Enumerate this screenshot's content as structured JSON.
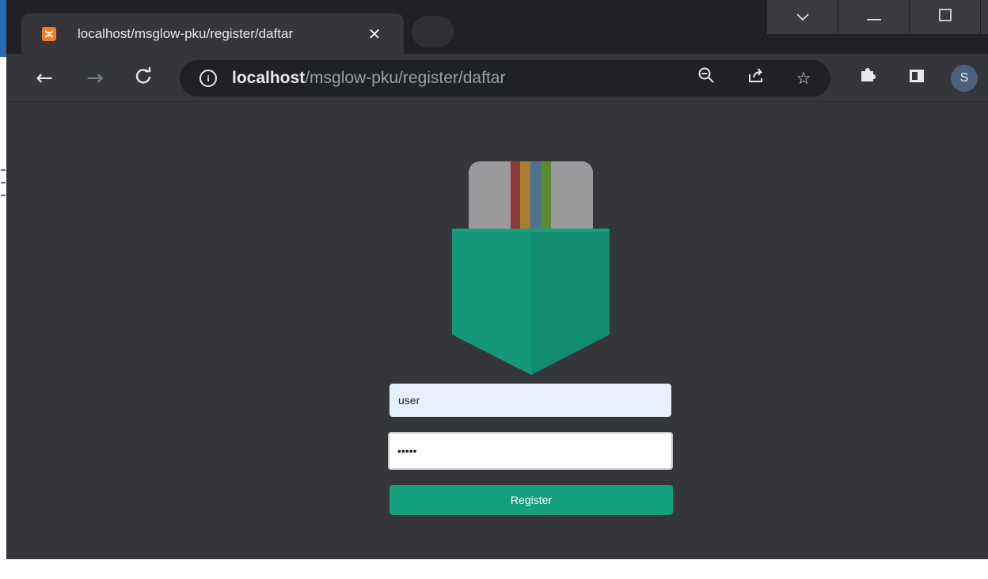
{
  "tab": {
    "title": "localhost/msglow-pku/register/daftar",
    "favicon_glyph": "ʚɞ",
    "close_icon": "✕"
  },
  "window_controls": {
    "dropdown": "⌄",
    "minimize": "—",
    "maximize": "☐"
  },
  "toolbar": {
    "back": "←",
    "forward": "→",
    "reload": "C",
    "url_host": "localhost",
    "url_path": "/msglow-pku/register/daftar",
    "info": "i",
    "zoom_icon": "⊖",
    "share_icon": "⇗",
    "bookmark_icon": "☆",
    "extensions_icon": "✱",
    "profile_initial": "S"
  },
  "form": {
    "username_value": "user",
    "password_value": "*****",
    "register_label": "Register"
  },
  "colors": {
    "page_background": "#35363a",
    "button_accent": "#14a07a",
    "pocket_green": "#15987a",
    "card_gray": "#9a9a9c",
    "stripe_red": "#8e3b3c",
    "stripe_orange": "#a97d33",
    "stripe_blue": "#4d7391",
    "stripe_green": "#5b8a35"
  }
}
